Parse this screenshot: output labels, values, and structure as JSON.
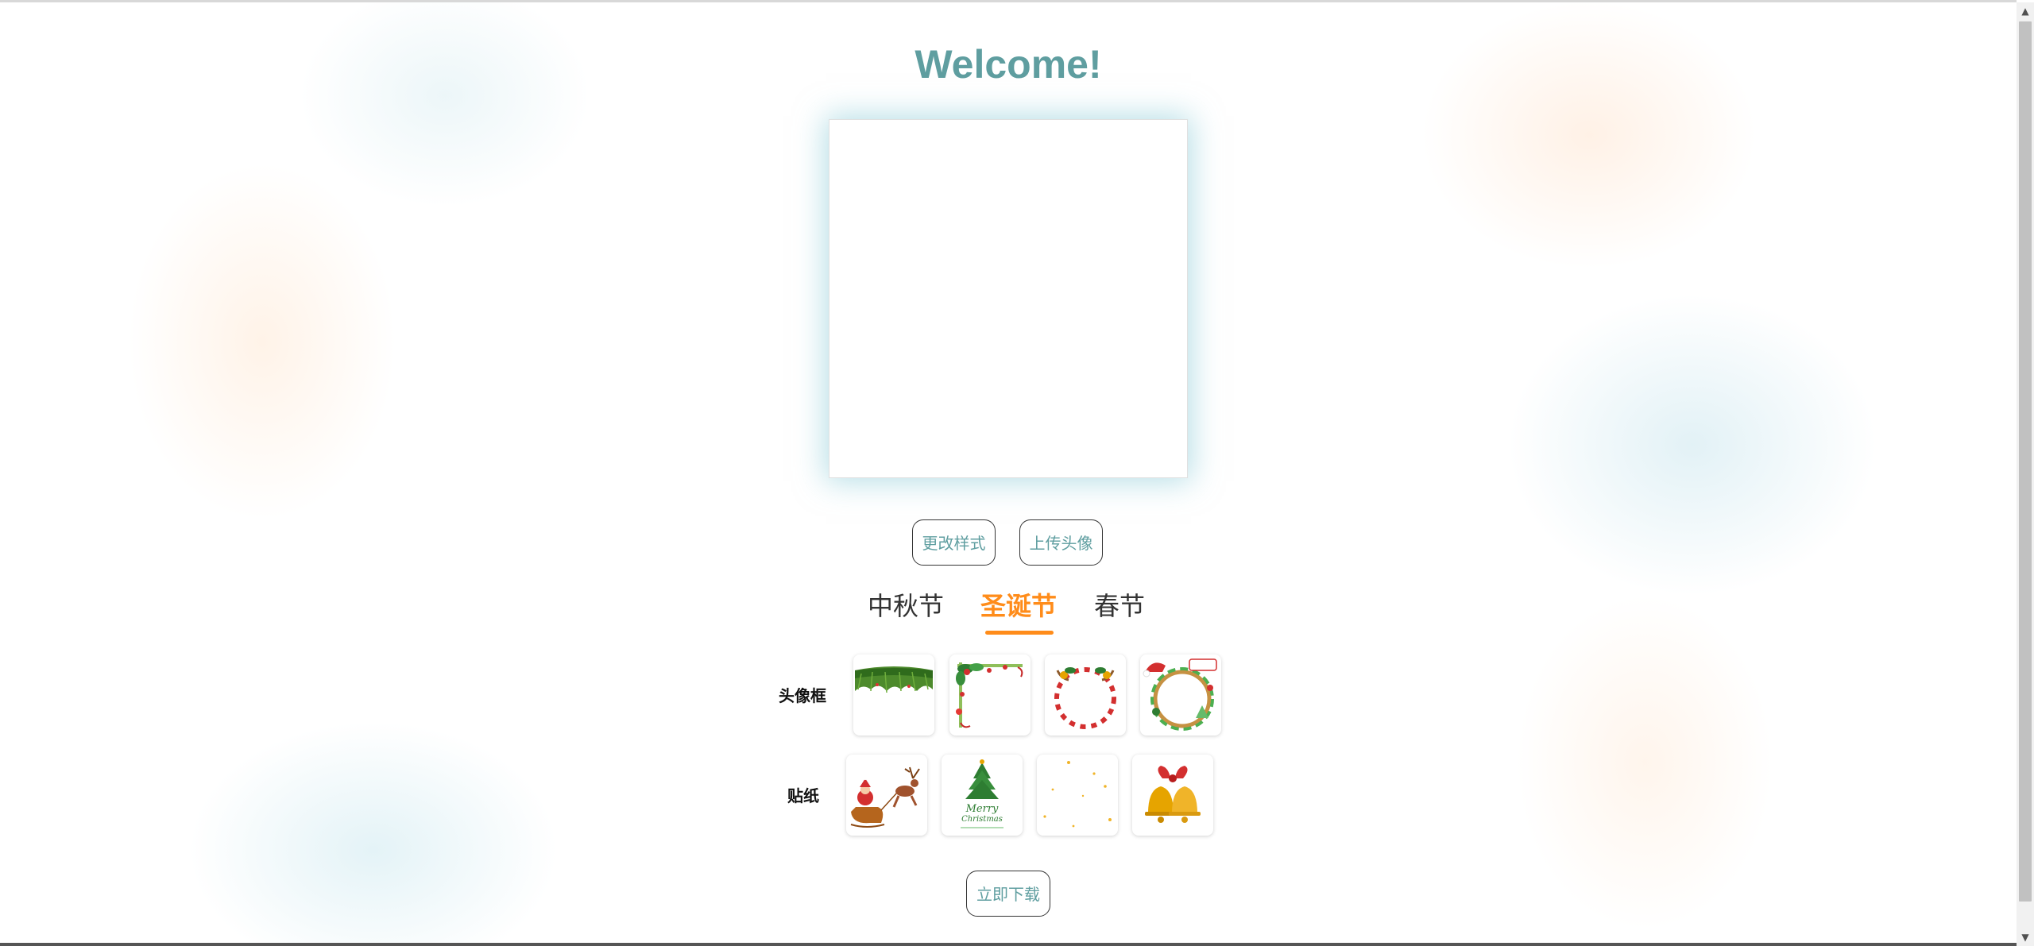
{
  "page": {
    "title": "Welcome!"
  },
  "actions": {
    "change_style_label": "更改样式",
    "upload_avatar_label": "上传头像",
    "download_label": "立即下载"
  },
  "tabs": [
    {
      "label": "中秋节",
      "active": false
    },
    {
      "label": "圣诞节",
      "active": true
    },
    {
      "label": "春节",
      "active": false
    }
  ],
  "rows": {
    "frames_label": "头像框",
    "stickers_label": "贴纸"
  },
  "frames": [
    {
      "icon": "pine-garland-frame-icon"
    },
    {
      "icon": "holly-corner-frame-icon"
    },
    {
      "icon": "candy-cane-ring-frame-icon"
    },
    {
      "icon": "santa-wreath-frame-icon"
    }
  ],
  "stickers": [
    {
      "icon": "santa-sleigh-reindeer-icon"
    },
    {
      "icon": "christmas-tree-icon"
    },
    {
      "icon": "gold-sparkles-icon"
    },
    {
      "icon": "christmas-bells-icon"
    }
  ],
  "colors": {
    "title": "#5f9ea0",
    "accent": "#ff8c1a",
    "button_text": "#5f9ea0",
    "canvas_glow": "#78c3d2"
  }
}
